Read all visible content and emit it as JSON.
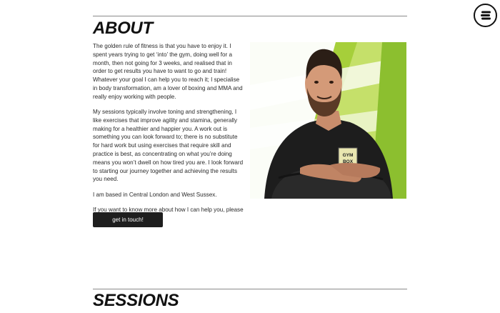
{
  "about": {
    "title": "ABOUT",
    "paragraphs": [
      "The golden rule of fitness is that you have to enjoy it. I spent years trying to get ‘into’ the gym, doing well for a month, then not going for 3 weeks, and realised that in order to get results you have to want to go and train! Whatever your goal I can help you to reach it; I specialise in body transformation, am a lover of boxing and MMA and really enjoy working with people.",
      "My sessions typically involve toning and strengthening, I like exercises that improve agility and stamina, generally making for a healthier and happier you. A work out is something you can look forward to; there is no substitute for hard work but using exercises that require skill and practice is best, as concentrating on what you’re doing means you won’t dwell on how tired you are. I look forward to starting our journey together and achieving the results you need.",
      "I am based in Central London and West Sussex.",
      "If you want to know more about how I can help you, please"
    ],
    "cta_label": "get in touch!",
    "photo_shirt_logo": [
      "GYM",
      "BOX"
    ]
  },
  "sessions": {
    "title": "SESSIONS"
  },
  "icons": {
    "menu": "menu-icon"
  },
  "colors": {
    "accent_green": "#a6cf3a",
    "button_bg": "#1e1e1e",
    "text": "#2a2a2a"
  }
}
